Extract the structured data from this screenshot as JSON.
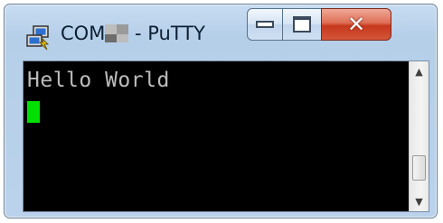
{
  "window": {
    "title": "COM",
    "title_suffix": " - PuTTY",
    "app_icon": "putty-computers-icon",
    "controls": {
      "minimize_icon": "minimize-icon",
      "maximize_icon": "maximize-icon",
      "close_icon": "close-icon",
      "close_glyph": "✕"
    }
  },
  "terminal": {
    "lines": [
      "Hello World"
    ],
    "cursor_color": "#00e000",
    "text_color": "#bdbdbd",
    "background": "#000000"
  },
  "scrollbar": {
    "up_glyph": "▲",
    "down_glyph": "▼"
  }
}
